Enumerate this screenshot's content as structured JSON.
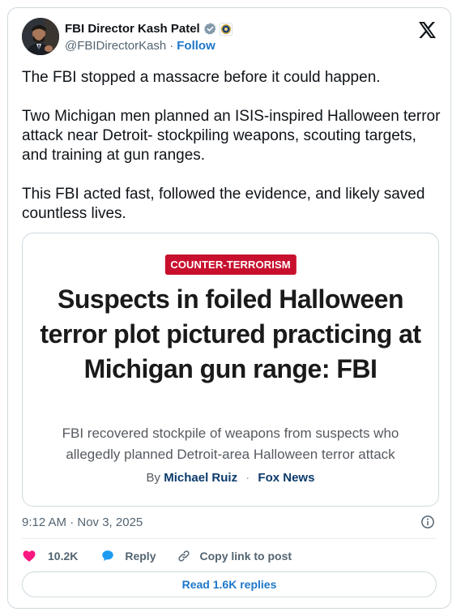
{
  "author": {
    "name": "FBI Director Kash Patel",
    "handle": "@FBIDirectorKash",
    "separator": "·",
    "follow_label": "Follow"
  },
  "icons": {
    "verified": "verified-badge-icon",
    "affiliation": "fbi-seal-icon",
    "platform": "x-logo-icon",
    "info": "info-icon",
    "like": "heart-icon",
    "reply": "reply-bubble-icon",
    "copy_link": "link-icon"
  },
  "tweet": {
    "paragraphs": [
      "The FBI stopped a massacre before it could happen.",
      "Two Michigan men planned an ISIS-inspired Halloween terror attack near Detroit- stockpiling weapons, scouting targets, and training at gun ranges.",
      "This FBI acted fast, followed the evidence, and likely saved countless lives."
    ]
  },
  "article": {
    "tag": "COUNTER-TERRORISM",
    "headline": "Suspects in foiled Halloween terror plot pictured practicing at Michigan gun range: FBI",
    "subhead": "FBI recovered stockpile of weapons from suspects who allegedly planned Detroit-area Halloween terror attack",
    "by": "By",
    "author": "Michael Ruiz",
    "separator": "·",
    "outlet": "Fox News"
  },
  "meta": {
    "timestamp": "9:12 AM · Nov 3, 2025"
  },
  "actions": {
    "like_count": "10.2K",
    "reply_label": "Reply",
    "copy_label": "Copy link to post",
    "read_replies_label": "Read 1.6K replies"
  },
  "colors": {
    "link_blue": "#1d77c9",
    "like_red": "#f91880",
    "tag_red": "#c8102e",
    "verified_grey": "#829aab"
  }
}
